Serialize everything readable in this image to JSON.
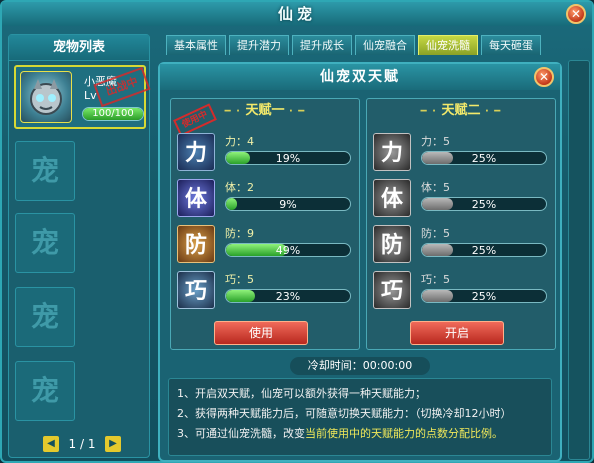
{
  "window": {
    "title": "仙宠",
    "close_label": "✕"
  },
  "left_panel": {
    "header": "宠物列表",
    "pet": {
      "name": "小恶魔",
      "level": "Lv",
      "stamp": "出战中",
      "hp_text": "100/100",
      "hp_fraction": 1.0
    },
    "empty_slot_glyph": "宠",
    "pager": {
      "prev": "◀",
      "text": "1 / 1",
      "next": "▶"
    }
  },
  "tabs": [
    "基本属性",
    "提升潜力",
    "提升成长",
    "仙宠融合",
    "仙宠洗髓",
    "每天砸蛋"
  ],
  "active_tab": 4,
  "dialog": {
    "title": "仙宠双天赋",
    "close_label": "✕",
    "talent_one": {
      "title": "天赋一",
      "stamp": "使用中",
      "stats": [
        {
          "icon": "力",
          "label": "力：4",
          "percent": 19,
          "text": "19%"
        },
        {
          "icon": "体",
          "label": "体：2",
          "percent": 9,
          "text": "9%"
        },
        {
          "icon": "防",
          "label": "防：9",
          "percent": 49,
          "text": "49%"
        },
        {
          "icon": "巧",
          "label": "巧：5",
          "percent": 23,
          "text": "23%"
        }
      ],
      "button": "使用"
    },
    "talent_two": {
      "title": "天赋二",
      "stats": [
        {
          "icon": "力",
          "label": "力：5",
          "percent": 25,
          "text": "25%"
        },
        {
          "icon": "体",
          "label": "体：5",
          "percent": 25,
          "text": "25%"
        },
        {
          "icon": "防",
          "label": "防：5",
          "percent": 25,
          "text": "25%"
        },
        {
          "icon": "巧",
          "label": "巧：5",
          "percent": 25,
          "text": "25%"
        }
      ],
      "button": "开启"
    },
    "cooldown": "冷却时间：00:00:00",
    "notes": [
      "1、开启双天赋，仙宠可以额外获得一种天赋能力；",
      "2、获得两种天赋能力后，可随意切换天赋能力：（切换冷却12小时）",
      "3、可通过仙宠洗髓，改变",
      "当前使用中的天赋能力的点数分配比例。"
    ]
  },
  "colors": {
    "accent": "#2ea7b4",
    "button_red": "#d23a2c",
    "progress_green": "#3fb83a",
    "highlight": "#f0e85a"
  }
}
